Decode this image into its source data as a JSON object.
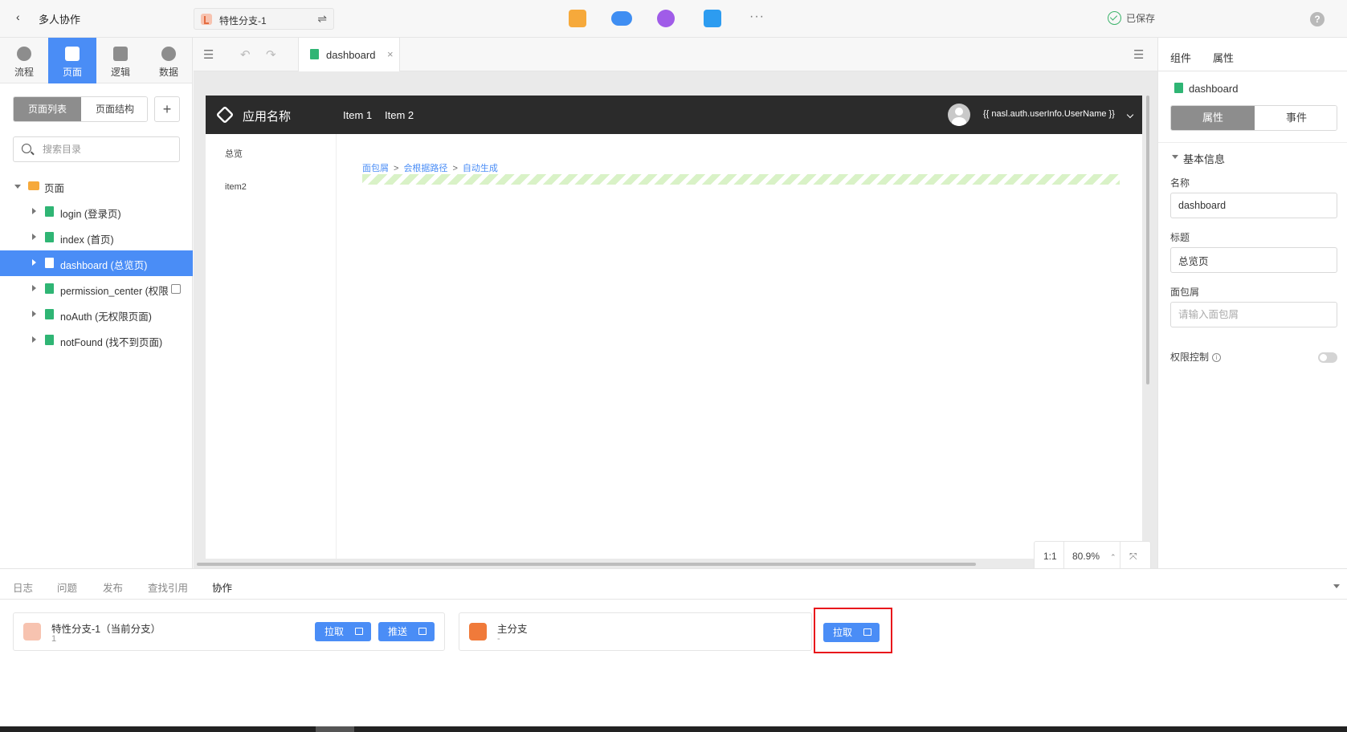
{
  "topbar": {
    "back_glyph": "‹",
    "title": "多人协作",
    "branch": {
      "label": "特性分支-1",
      "swap_glyph": "⇌"
    },
    "tool_icons": [
      {
        "name": "run-icon",
        "color": "#f6a93b"
      },
      {
        "name": "cloud-icon",
        "color": "#3f8ef2"
      },
      {
        "name": "publish-icon",
        "color": "#a05ce8"
      },
      {
        "name": "sync-icon",
        "color": "#2d9cf0"
      }
    ],
    "more_glyph": "···",
    "saved": "已保存",
    "help_glyph": "?"
  },
  "leftnav": {
    "items": [
      {
        "label": "流程",
        "active": false
      },
      {
        "label": "页面",
        "active": true
      },
      {
        "label": "逻辑",
        "active": false
      },
      {
        "label": "数据",
        "active": false
      }
    ]
  },
  "leftpanel": {
    "seg_on": "页面列表",
    "seg_off": "页面结构",
    "plus": "+",
    "search_placeholder": "搜索目录",
    "root": "页面",
    "pages": [
      {
        "label": "login (登录页)",
        "selected": false
      },
      {
        "label": "index (首页)",
        "selected": false
      },
      {
        "label": "dashboard (总览页)",
        "selected": true
      },
      {
        "label": "permission_center (权限",
        "selected": false
      },
      {
        "label": "noAuth (无权限页面)",
        "selected": false
      },
      {
        "label": "notFound (找不到页面)",
        "selected": false
      }
    ]
  },
  "tabbar": {
    "tab_label": "dashboard",
    "close_glyph": "×",
    "undo_glyph": "↶",
    "redo_glyph": "↷",
    "collapse_glyph": "☰",
    "expand_glyph": "☰"
  },
  "app": {
    "name": "应用名称",
    "nav": [
      "Item 1",
      "Item 2"
    ],
    "user": "{{ nasl.auth.userInfo.UserName }}",
    "side": [
      "总览",
      "item2"
    ],
    "crumbs": [
      "面包屑",
      "会根据路径",
      "自动生成"
    ],
    "crumb_sep": ">"
  },
  "zoom": {
    "ratio": "1:1",
    "value": "80.9%",
    "caret": "⌃",
    "fit_glyph": "⤧"
  },
  "rightpanel": {
    "tabs": [
      "组件",
      "属性"
    ],
    "doc": "dashboard",
    "seg_on": "属性",
    "seg_off": "事件",
    "section": "基本信息",
    "name_label": "名称",
    "name_value": "dashboard",
    "title_label": "标题",
    "title_value": "总览页",
    "crumb_label": "面包屑",
    "crumb_placeholder": "请输入面包屑",
    "perm_label": "权限控制",
    "info_glyph": "i"
  },
  "bottom": {
    "tabs": [
      {
        "label": "日志",
        "active": false
      },
      {
        "label": "问题",
        "active": false
      },
      {
        "label": "发布",
        "active": false
      },
      {
        "label": "查找引用",
        "active": false
      },
      {
        "label": "协作",
        "active": true
      }
    ],
    "current_branch": {
      "name": "特性分支-1（当前分支）",
      "sub": "1",
      "pull": "拉取",
      "push": "推送",
      "icon_color": "#f7c3b0"
    },
    "main_branch": {
      "name": "主分支",
      "sub": "-",
      "pull": "拉取",
      "icon_color": "#f07a3a"
    }
  }
}
